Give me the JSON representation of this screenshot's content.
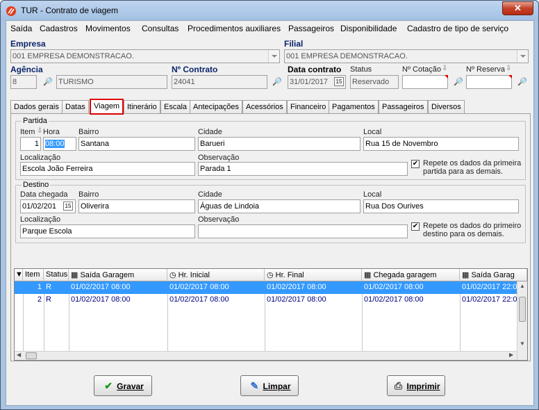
{
  "window": {
    "title": "TUR - Contrato de viagem",
    "close_label": "✕"
  },
  "menu": [
    "Saída",
    "Cadastros",
    "Movimentos",
    "Consultas",
    "Procedimentos auxiliares",
    "Passageiros",
    "Disponibilidade",
    "Cadastro de tipo de serviço"
  ],
  "header": {
    "empresa_label": "Empresa",
    "empresa_value": "001 EMPRESA DEMONSTRACAO.",
    "filial_label": "Filial",
    "filial_value": "001 EMPRESA DEMONSTRACAO.",
    "agencia_label": "Agência",
    "agencia_code": "8",
    "agencia_name": "TURISMO",
    "contrato_label": "Nº Contrato",
    "contrato_value": "24041",
    "data_contrato_label": "Data contrato",
    "data_contrato_value": "31/01/2017",
    "status_label": "Status",
    "status_value": "Reservado",
    "cotacao_label": "Nº Cotação",
    "cotacao_value": "",
    "reserva_label": "Nº Reserva",
    "reserva_value": ""
  },
  "tabs": [
    "Dados gerais",
    "Datas",
    "Viagem",
    "Itinerário",
    "Escala",
    "Antecipações",
    "Acessórios",
    "Financeiro",
    "Pagamentos",
    "Passageiros",
    "Diversos"
  ],
  "active_tab": "Viagem",
  "partida": {
    "title": "Partida",
    "item_label": "Item",
    "hora_label": "Hora",
    "bairro_label": "Bairro",
    "cidade_label": "Cidade",
    "local_label": "Local",
    "item": "1",
    "hora": "08:00",
    "bairro": "Santana",
    "cidade": "Barueri",
    "local": "Rua 15 de Novembro",
    "localizacao_label": "Localização",
    "observacao_label": "Observação",
    "localizacao": "Escola João Ferreira",
    "observacao": "Parada 1",
    "repeat_line1": "Repete os dados da primeira",
    "repeat_line2": "partida para as demais.",
    "repeat_checked": true
  },
  "destino": {
    "title": "Destino",
    "data_chegada_label": "Data chegada",
    "bairro_label": "Bairro",
    "cidade_label": "Cidade",
    "local_label": "Local",
    "data_chegada": "01/02/201",
    "bairro": "Oliverira",
    "cidade": "Águas de Lindoia",
    "local": "Rua Dos Ourives",
    "localizacao_label": "Localização",
    "observacao_label": "Observação",
    "localizacao": "Parque Escola",
    "observacao": "",
    "repeat_line1": "Repete os dados do primeiro",
    "repeat_line2": "destino para os demais.",
    "repeat_checked": true
  },
  "grid": {
    "columns": [
      "Item",
      "Status",
      "Saída Garagem",
      "Hr. Inicial",
      "Hr. Final",
      "Chegada garagem",
      "Saída Garag"
    ],
    "rows": [
      [
        "1",
        "R",
        "01/02/2017 08:00",
        "01/02/2017 08:00",
        "01/02/2017 08:00",
        "01/02/2017 08:00",
        "01/02/2017 22:0"
      ],
      [
        "2",
        "R",
        "01/02/2017 08:00",
        "01/02/2017 08:00",
        "01/02/2017 08:00",
        "01/02/2017 08:00",
        "01/02/2017 22:0"
      ]
    ]
  },
  "buttons": {
    "gravar": "Gravar",
    "limpar": "Limpar",
    "imprimir": "Imprimir"
  },
  "colors": {
    "selection": "#3399ff",
    "label_blue": "#0a246a",
    "tab_highlight": "#dd0000"
  }
}
